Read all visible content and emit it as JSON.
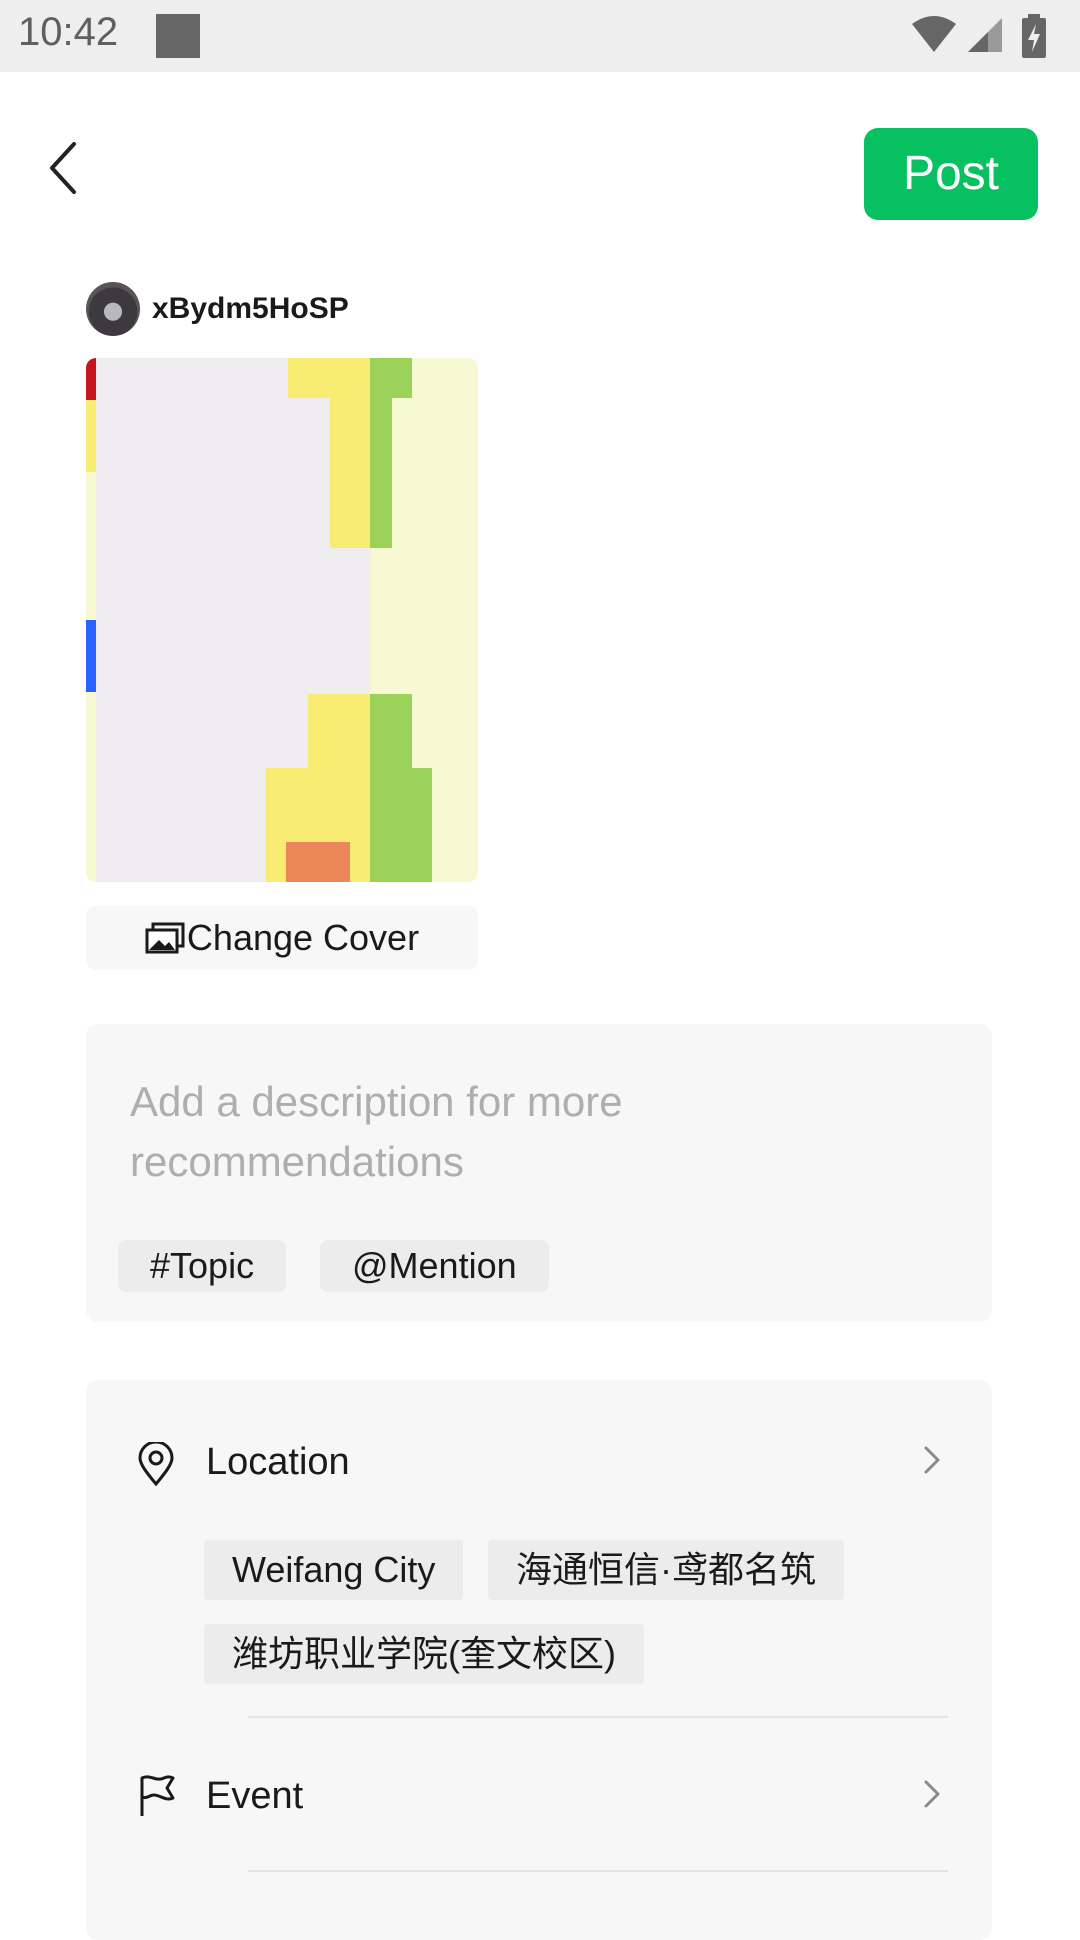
{
  "status_bar": {
    "time": "10:42"
  },
  "header": {
    "back_icon": "chevron-left-icon",
    "post_label": "Post",
    "accent_color": "#07c160"
  },
  "author": {
    "username": "xBydm5HoSP"
  },
  "cover": {
    "change_cover_label": "Change Cover",
    "change_cover_icon": "images-icon"
  },
  "description": {
    "placeholder": "Add a description for more recommendations",
    "topic_label": "#Topic",
    "mention_label": "@Mention"
  },
  "options": {
    "location": {
      "label": "Location",
      "icon": "location-pin-icon",
      "suggestions": [
        "Weifang City",
        "海通恒信·鸢都名筑",
        "潍坊职业学院(奎文校区)"
      ]
    },
    "event": {
      "label": "Event",
      "icon": "flag-icon"
    }
  }
}
